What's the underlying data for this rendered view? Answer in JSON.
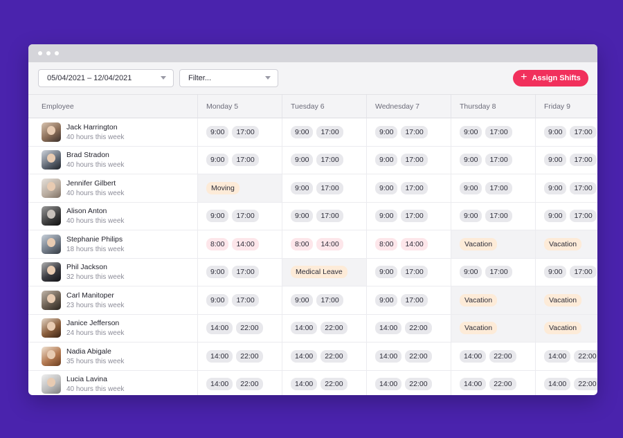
{
  "toolbar": {
    "date_range": "05/04/2021 – 12/04/2021",
    "filter_placeholder": "Filter...",
    "assign_label": "Assign Shifts"
  },
  "columns": [
    "Employee",
    "Monday 5",
    "Tuesday 6",
    "Wednesday 7",
    "Thursday 8",
    "Friday 9"
  ],
  "employees": [
    {
      "name": "Jack Harrington",
      "hours": "40 hours this week",
      "shifts": [
        [
          "9:00",
          "17:00"
        ],
        [
          "9:00",
          "17:00"
        ],
        [
          "9:00",
          "17:00"
        ],
        [
          "9:00",
          "17:00"
        ],
        [
          "9:00",
          "17:00"
        ]
      ]
    },
    {
      "name": "Brad Stradon",
      "hours": "40 hours this week",
      "shifts": [
        [
          "9:00",
          "17:00"
        ],
        [
          "9:00",
          "17:00"
        ],
        [
          "9:00",
          "17:00"
        ],
        [
          "9:00",
          "17:00"
        ],
        [
          "9:00",
          "17:00"
        ]
      ]
    },
    {
      "name": "Jennifer Gilbert",
      "hours": "40 hours this week",
      "shifts": [
        "Moving",
        [
          "9:00",
          "17:00"
        ],
        [
          "9:00",
          "17:00"
        ],
        [
          "9:00",
          "17:00"
        ],
        [
          "9:00",
          "17:00"
        ]
      ]
    },
    {
      "name": "Alison Anton",
      "hours": "40 hours this week",
      "shifts": [
        [
          "9:00",
          "17:00"
        ],
        [
          "9:00",
          "17:00"
        ],
        [
          "9:00",
          "17:00"
        ],
        [
          "9:00",
          "17:00"
        ],
        [
          "9:00",
          "17:00"
        ]
      ]
    },
    {
      "name": "Stephanie Philips",
      "hours": "18 hours this week",
      "shifts": [
        [
          "8:00",
          "14:00"
        ],
        [
          "8:00",
          "14:00"
        ],
        [
          "8:00",
          "14:00"
        ],
        "Vacation",
        "Vacation"
      ]
    },
    {
      "name": "Phil Jackson",
      "hours": "32 hours this week",
      "shifts": [
        [
          "9:00",
          "17:00"
        ],
        "Medical Leave",
        [
          "9:00",
          "17:00"
        ],
        [
          "9:00",
          "17:00"
        ],
        [
          "9:00",
          "17:00"
        ]
      ]
    },
    {
      "name": "Carl Manitoper",
      "hours": "23 hours this week",
      "shifts": [
        [
          "9:00",
          "17:00"
        ],
        [
          "9:00",
          "17:00"
        ],
        [
          "9:00",
          "17:00"
        ],
        "Vacation",
        "Vacation"
      ]
    },
    {
      "name": "Janice Jefferson",
      "hours": "24 hours this week",
      "shifts": [
        [
          "14:00",
          "22:00"
        ],
        [
          "14:00",
          "22:00"
        ],
        [
          "14:00",
          "22:00"
        ],
        "Vacation",
        "Vacation"
      ]
    },
    {
      "name": "Nadia Abigale",
      "hours": "35 hours this week",
      "shifts": [
        [
          "14:00",
          "22:00"
        ],
        [
          "14:00",
          "22:00"
        ],
        [
          "14:00",
          "22:00"
        ],
        [
          "14:00",
          "22:00"
        ],
        [
          "14:00",
          "22:00"
        ]
      ]
    },
    {
      "name": "Lucia Lavina",
      "hours": "40 hours this week",
      "shifts": [
        [
          "14:00",
          "22:00"
        ],
        [
          "14:00",
          "22:00"
        ],
        [
          "14:00",
          "22:00"
        ],
        [
          "14:00",
          "22:00"
        ],
        [
          "14:00",
          "22:00"
        ]
      ]
    }
  ],
  "colors": {
    "background": "#4a23ad",
    "accent": "#f1305c",
    "leave_pill": "#fdebd8",
    "pink_pill": "#fde6ea",
    "shift_pill": "#e8e8ec"
  }
}
